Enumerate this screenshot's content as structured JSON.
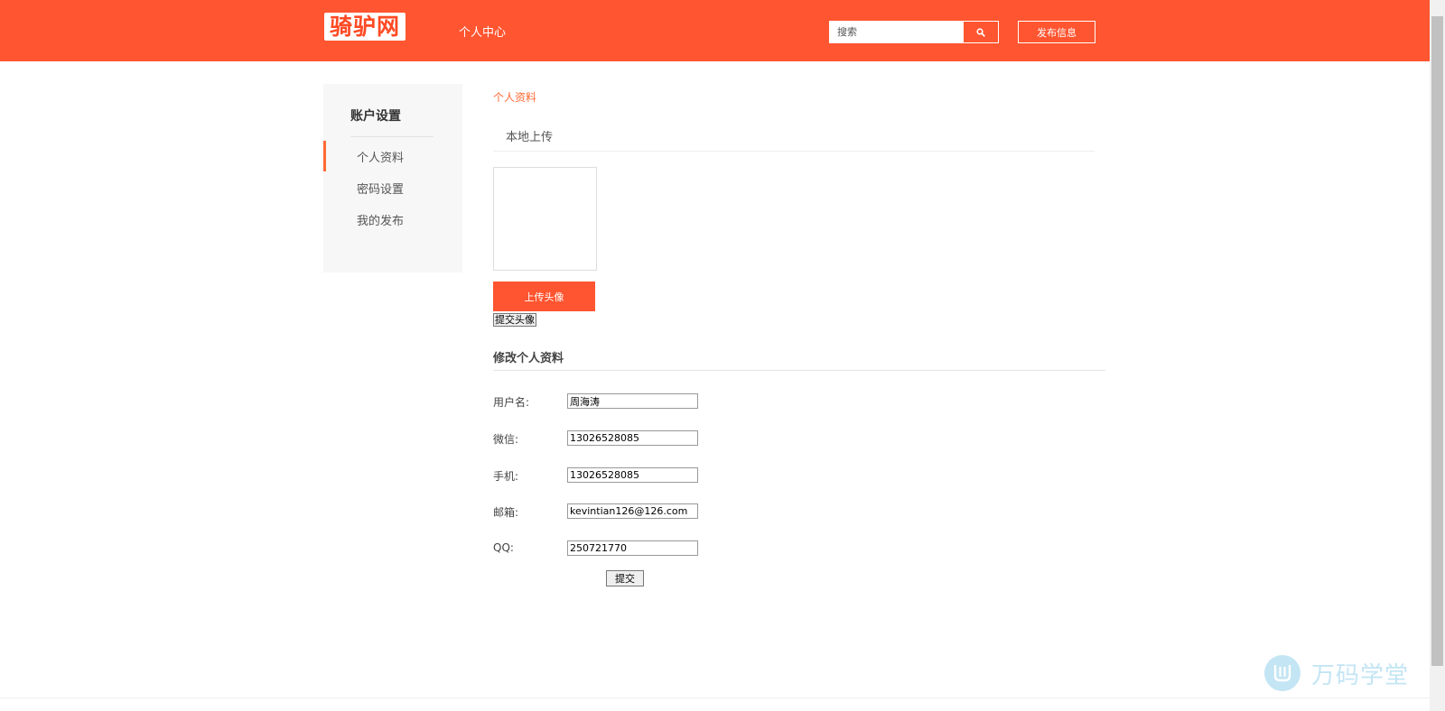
{
  "header": {
    "logo_text": "骑驴网",
    "nav_label": "个人中心",
    "search_placeholder": "搜索",
    "search_icon": "search-icon",
    "publish_label": "发布信息",
    "background_color": "#ff5530"
  },
  "sidebar": {
    "title": "账户设置",
    "items": [
      {
        "label": "个人资料",
        "active": true
      },
      {
        "label": "密码设置",
        "active": false
      },
      {
        "label": "我的发布",
        "active": false
      }
    ]
  },
  "main": {
    "breadcrumb": "个人资料",
    "upload_tab": "本地上传",
    "upload_avatar_label": "上传头像",
    "submit_avatar_label": "提交头像",
    "section_title": "修改个人资料",
    "fields": [
      {
        "label": "用户名:",
        "value": "周海涛"
      },
      {
        "label": "微信:",
        "value": "13026528085"
      },
      {
        "label": "手机:",
        "value": "13026528085"
      },
      {
        "label": "邮箱:",
        "value": "kevintian126@126.com"
      },
      {
        "label": "QQ:",
        "value": "250721770"
      }
    ],
    "submit_label": "提交"
  },
  "watermark": {
    "text": "万码学堂"
  },
  "accent_color": "#ff6a35"
}
